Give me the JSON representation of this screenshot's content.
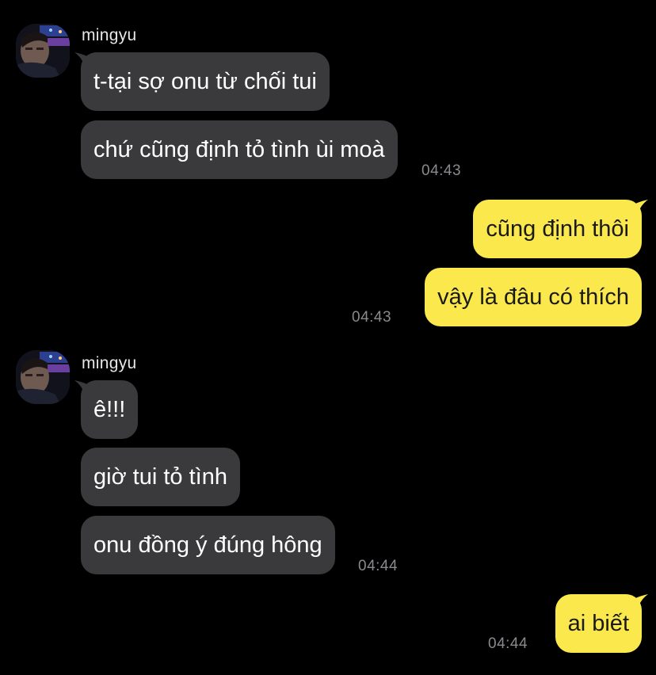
{
  "colors": {
    "background": "#000000",
    "incoming_bubble": "#3a3a3c",
    "outgoing_bubble": "#fae84c",
    "timestamp": "#8a8a8e"
  },
  "chat": {
    "group1": {
      "sender": "mingyu",
      "messages": [
        "t-tại sợ onu từ chối tui",
        "chứ cũng định tỏ tình ùi moà"
      ],
      "time": "04:43"
    },
    "group2": {
      "messages": [
        "cũng định thôi",
        "vậy là đâu có thích"
      ],
      "time": "04:43"
    },
    "group3": {
      "sender": "mingyu",
      "messages": [
        "ê!!!",
        "giờ tui tỏ tình",
        "onu đồng ý đúng hông"
      ],
      "time": "04:44"
    },
    "group4": {
      "messages": [
        "ai biết"
      ],
      "time": "04:44"
    }
  }
}
